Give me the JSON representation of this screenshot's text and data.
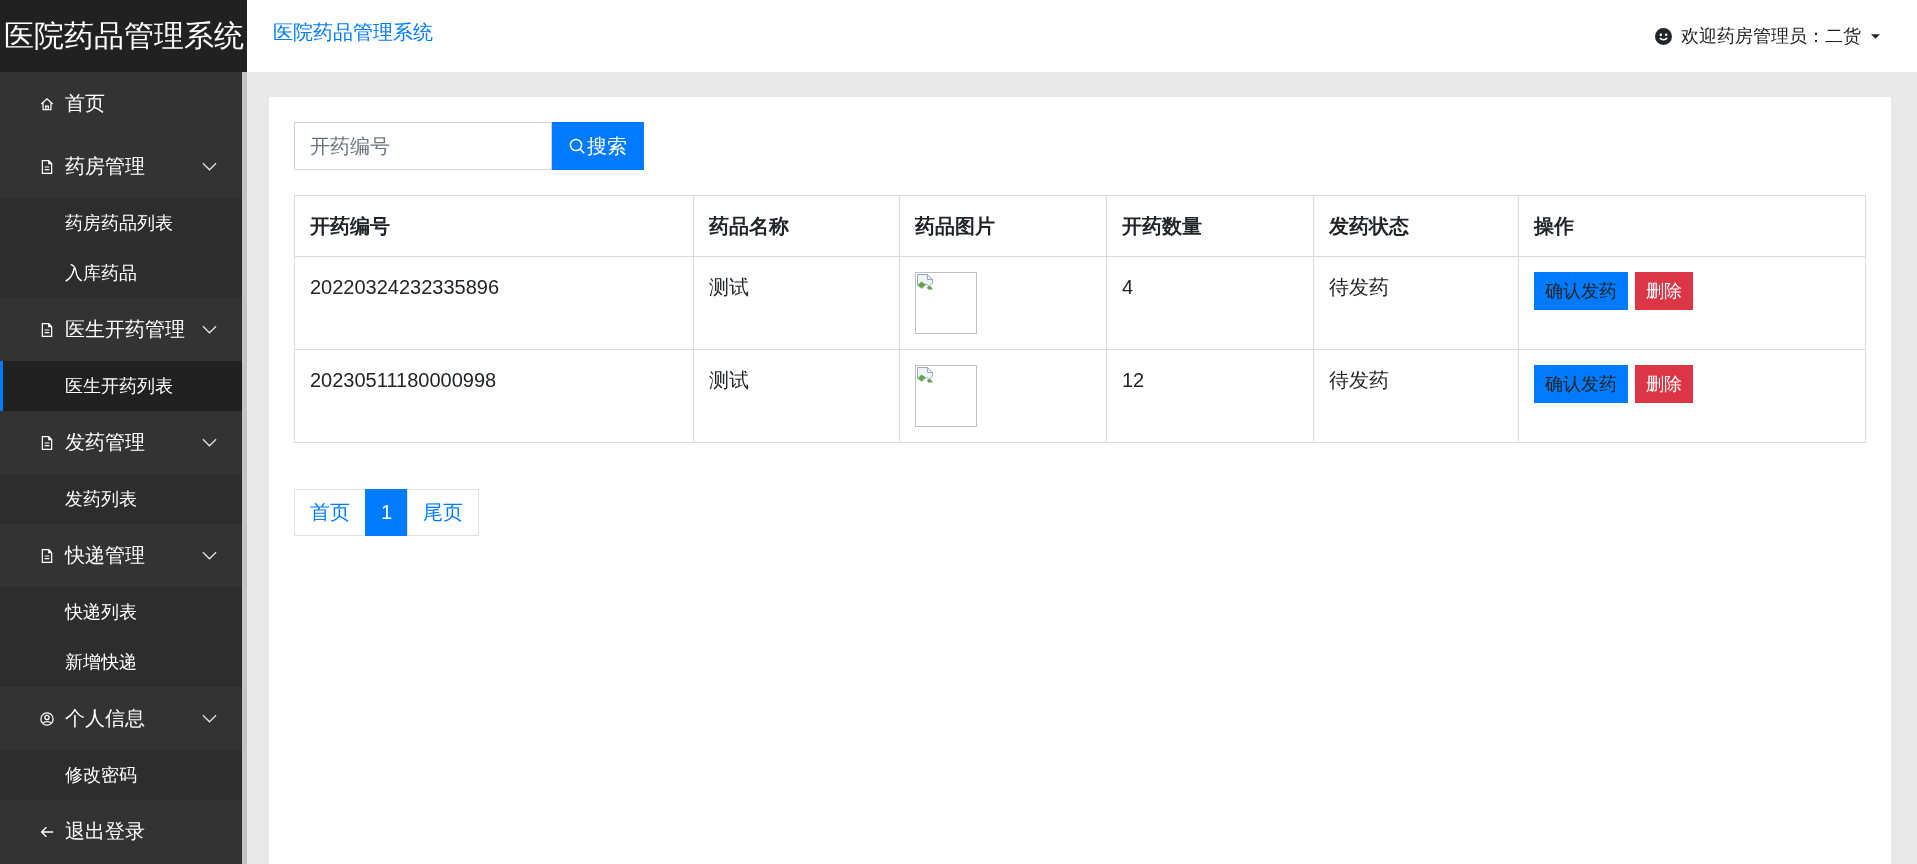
{
  "sidebar": {
    "logo": "医院药品管理系统",
    "items": [
      {
        "kind": "home",
        "label": "首页",
        "selected": false
      },
      {
        "kind": "section",
        "label": "药房管理",
        "selected": false,
        "expanded": true,
        "children": [
          {
            "label": "药房药品列表",
            "selected": false
          },
          {
            "label": "入库药品",
            "selected": false
          }
        ]
      },
      {
        "kind": "section",
        "label": "医生开药管理",
        "selected": false,
        "expanded": true,
        "children": [
          {
            "label": "医生开药列表",
            "selected": true
          }
        ]
      },
      {
        "kind": "section",
        "label": "发药管理",
        "selected": false,
        "expanded": true,
        "children": [
          {
            "label": "发药列表",
            "selected": false
          }
        ]
      },
      {
        "kind": "section",
        "label": "快递管理",
        "selected": false,
        "expanded": true,
        "children": [
          {
            "label": "快递列表",
            "selected": false
          },
          {
            "label": "新增快递",
            "selected": false
          }
        ]
      },
      {
        "kind": "profile",
        "label": "个人信息",
        "selected": false,
        "expanded": true,
        "children": [
          {
            "label": "修改密码",
            "selected": false
          }
        ]
      },
      {
        "kind": "logout",
        "label": "退出登录",
        "selected": false
      }
    ]
  },
  "header": {
    "title": "医院药品管理系统",
    "user_menu": "欢迎药房管理员：二货"
  },
  "search": {
    "placeholder": "开药编号",
    "button": "搜索"
  },
  "table": {
    "columns": [
      "开药编号",
      "药品名称",
      "药品图片",
      "开药数量",
      "发药状态",
      "操作"
    ],
    "rows": [
      {
        "prescription_no": "20220324232335896",
        "drug_name": "测试",
        "image_loaded": false,
        "quantity": "4",
        "status": "待发药",
        "actions": [
          {
            "kind": "confirm",
            "label": "确认发药"
          },
          {
            "kind": "delete",
            "label": "删除"
          }
        ]
      },
      {
        "prescription_no": "20230511180000998",
        "drug_name": "测试",
        "image_loaded": false,
        "quantity": "12",
        "status": "待发药",
        "actions": [
          {
            "kind": "confirm",
            "label": "确认发药"
          },
          {
            "kind": "delete",
            "label": "删除"
          }
        ]
      }
    ]
  },
  "pagination": {
    "pages": [
      {
        "label": "首页",
        "selected": false
      },
      {
        "label": "1",
        "selected": true
      },
      {
        "label": "尾页",
        "selected": false
      }
    ]
  }
}
